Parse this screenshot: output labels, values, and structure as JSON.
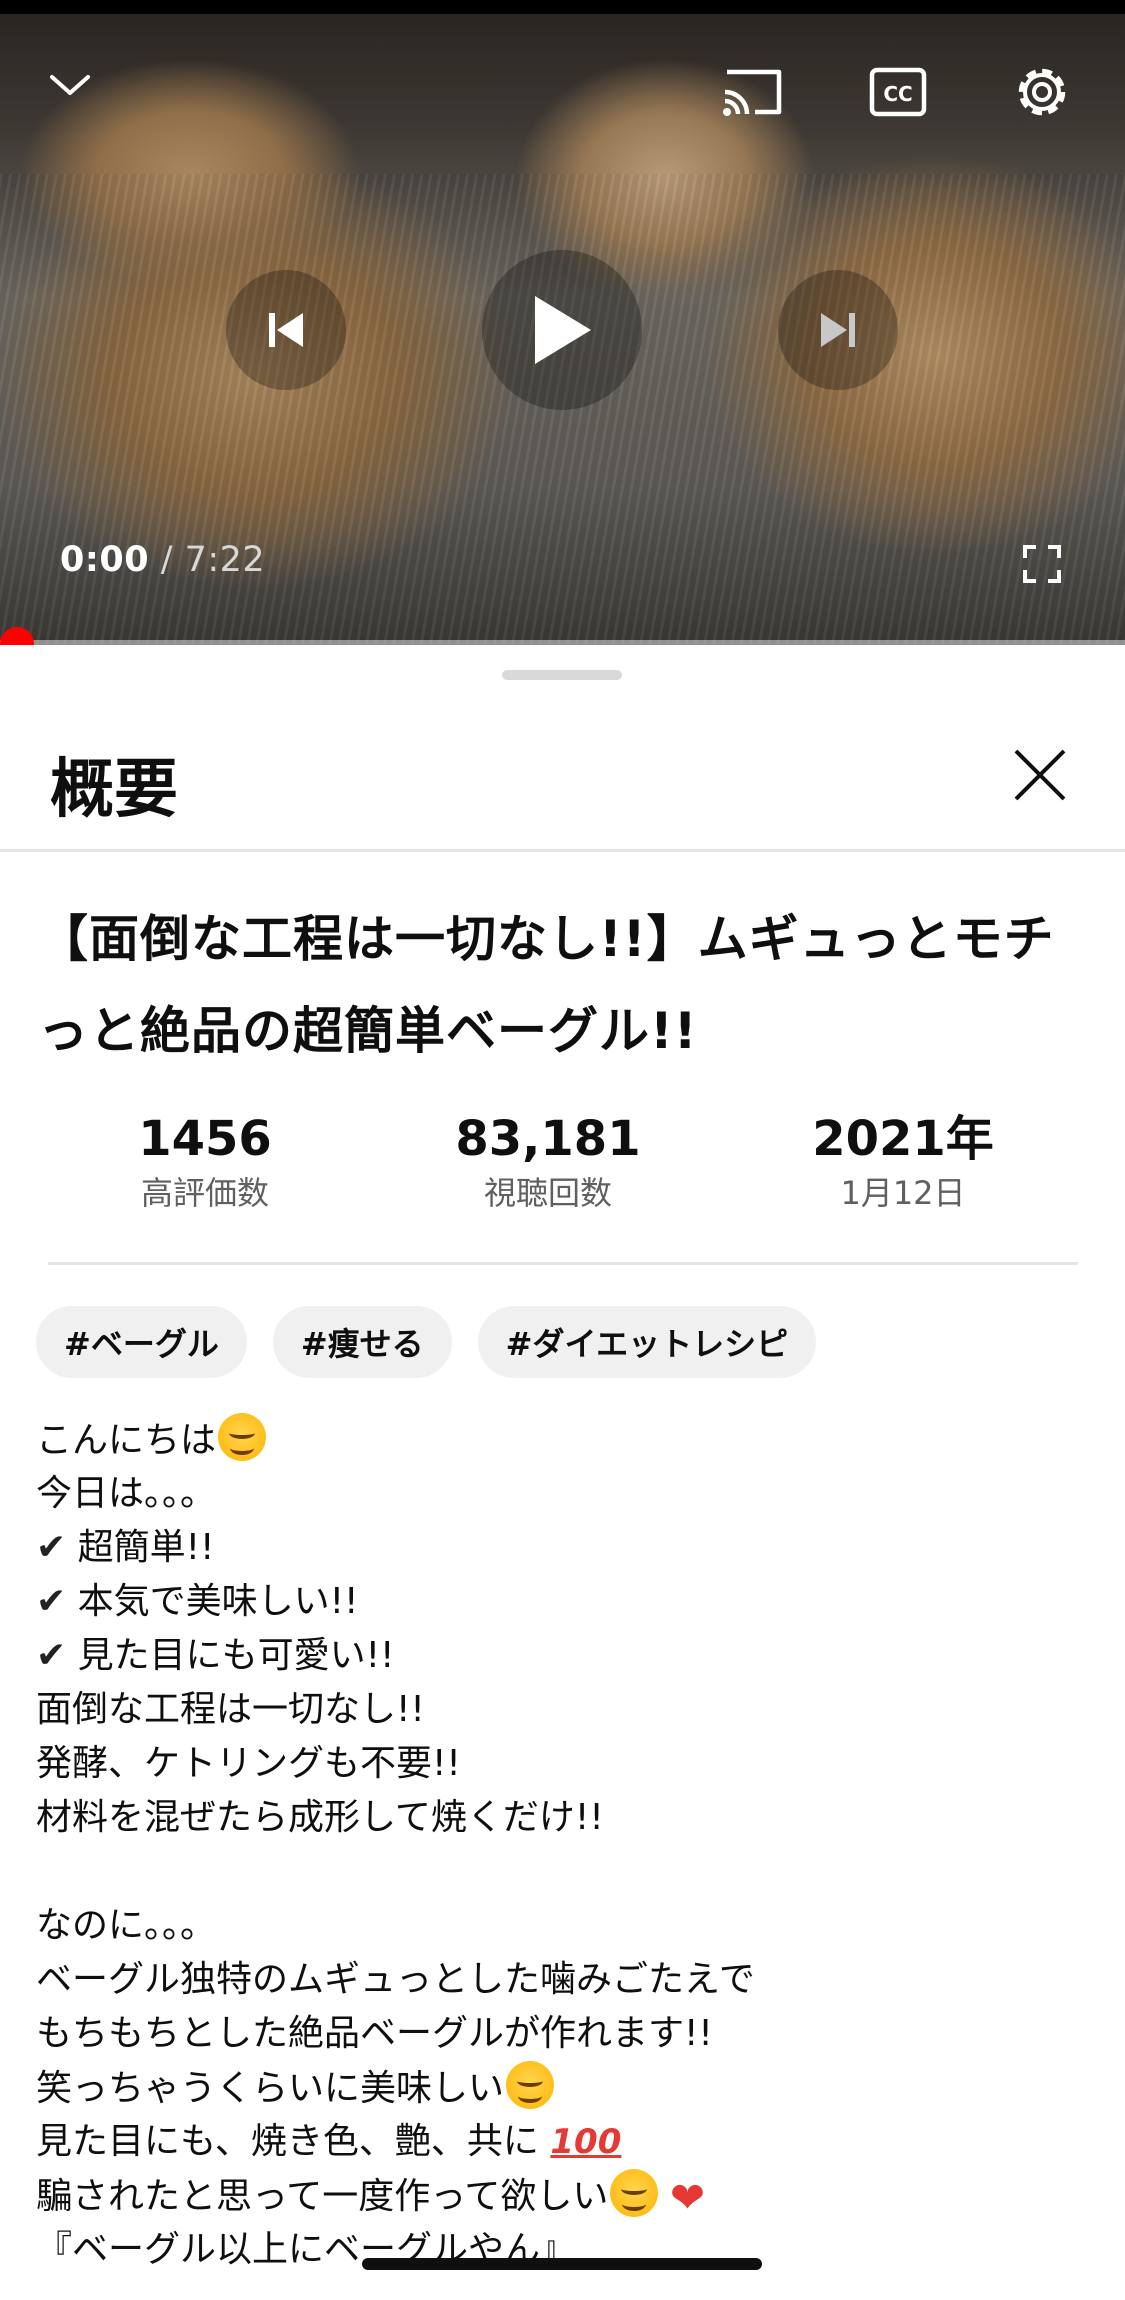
{
  "player": {
    "current_time": "0:00",
    "duration": " / 7:22",
    "progress": 0.0,
    "icons": {
      "collapse": "chevron-down-icon",
      "cast": "cast-icon",
      "captions": "captions-icon",
      "settings": "gear-icon",
      "previous": "skip-previous-icon",
      "play": "play-icon",
      "next": "skip-next-icon",
      "fullscreen": "fullscreen-icon"
    },
    "colors": {
      "progress": "#ff0000"
    }
  },
  "sheet": {
    "title": "概要",
    "close_icon": "close-icon"
  },
  "video": {
    "title_line1": "【面倒な工程は一切なし!!】ムギュっとモチ",
    "title_line2": "っと絶品の超簡単ベーグル!!",
    "stats": [
      {
        "value": "1456",
        "label": "高評価数"
      },
      {
        "value": "83,181",
        "label": "視聴回数"
      },
      {
        "value": "2021年",
        "label": "1月12日"
      }
    ],
    "tags": [
      "#ベーグル",
      "#痩せる",
      "#ダイエットレシピ"
    ]
  },
  "description": {
    "lines": [
      "こんにちは",
      "今日は。。。",
      "超簡単!!",
      "本気で美味しい!!",
      "見た目にも可愛い!!",
      "面倒な工程は一切なし!!",
      "発酵、ケトリングも不要!!",
      "材料を混ぜたら成形して焼くだけ!!",
      "",
      "なのに。。。",
      "ベーグル独特のムギュっとした噛みごたえで",
      "もちもちとした絶品ベーグルが作れます!!",
      "笑っちゃうくらいに美味しい",
      "見た目にも、焼き色、艶、共に",
      "騙されたと思って一度作って欲しい",
      "『ベーグル以上にベーグルやん』"
    ],
    "check_glyph": "✔",
    "hundred_glyph": "100",
    "heart_glyph": "❤"
  }
}
